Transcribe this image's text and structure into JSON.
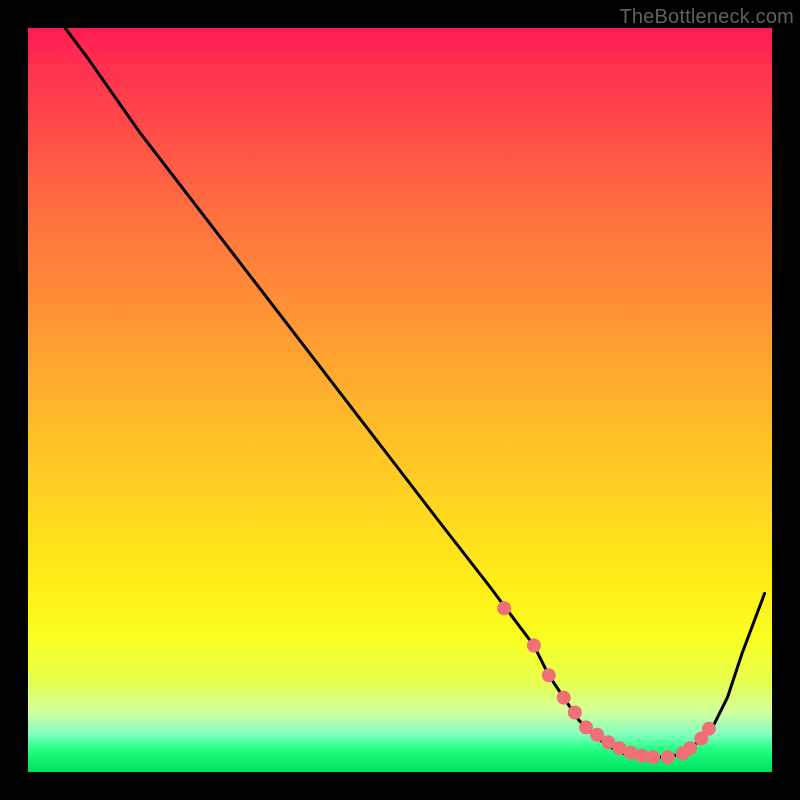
{
  "watermark": "TheBottleneck.com",
  "chart_data": {
    "type": "line",
    "title": "",
    "xlabel": "",
    "ylabel": "",
    "xlim": [
      0,
      100
    ],
    "ylim": [
      0,
      100
    ],
    "series": [
      {
        "name": "bottleneck-curve",
        "x": [
          5,
          8,
          15,
          25,
          35,
          45,
          55,
          62,
          65,
          68,
          70,
          72,
          74,
          76,
          78,
          80,
          82,
          84,
          86,
          88,
          90,
          92,
          94,
          96,
          99
        ],
        "values": [
          100,
          96,
          86,
          73,
          60,
          47,
          34,
          25,
          21,
          17,
          13,
          10,
          7,
          5,
          3.5,
          2.5,
          2,
          2,
          2,
          2.5,
          4,
          6,
          10,
          16,
          24
        ]
      }
    ],
    "markers": {
      "name": "highlight-points",
      "x": [
        64,
        68,
        70,
        72,
        73.5,
        75,
        76.5,
        78,
        79.5,
        81,
        82.5,
        84,
        86,
        88,
        89,
        90.5,
        91.5
      ],
      "values": [
        22,
        17,
        13,
        10,
        8,
        6,
        5,
        4,
        3.2,
        2.6,
        2.2,
        2,
        2,
        2.5,
        3.2,
        4.5,
        5.8
      ]
    },
    "marker_style": {
      "color": "#f07078",
      "size": 7
    }
  }
}
